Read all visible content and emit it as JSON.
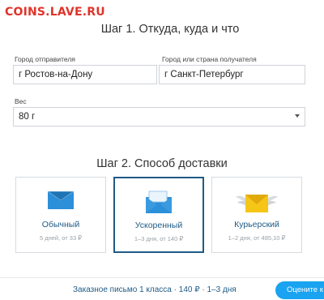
{
  "watermark": "COINS.LAVE.RU",
  "step1": {
    "title": "Шаг 1. Откуда, куда и что",
    "from_label": "Город отправителя",
    "from_value": "г Ростов-на-Дону",
    "to_label": "Город или страна получателя",
    "to_value": "г Санкт-Петербург",
    "weight_label": "Вес",
    "weight_value": "80 г"
  },
  "step2": {
    "title": "Шаг 2. Способ доставки",
    "options": [
      {
        "name": "Обычный",
        "meta": "5 дней, от 33 ₽"
      },
      {
        "name": "Ускоренный",
        "meta": "1–3 дня, от 140 ₽"
      },
      {
        "name": "Курьерский",
        "meta": "1–2 дня, от 485,10 ₽"
      }
    ]
  },
  "footer": {
    "summary": "Заказное письмо 1 класса · 140 ₽ · 1–3 дня",
    "cta_label": "Оцените к"
  },
  "colors": {
    "accent": "#1f5b86",
    "cta": "#1aa3f0",
    "watermark": "#e0342a",
    "envelope_blue": "#2b8fd9",
    "envelope_yellow": "#f5c518"
  }
}
